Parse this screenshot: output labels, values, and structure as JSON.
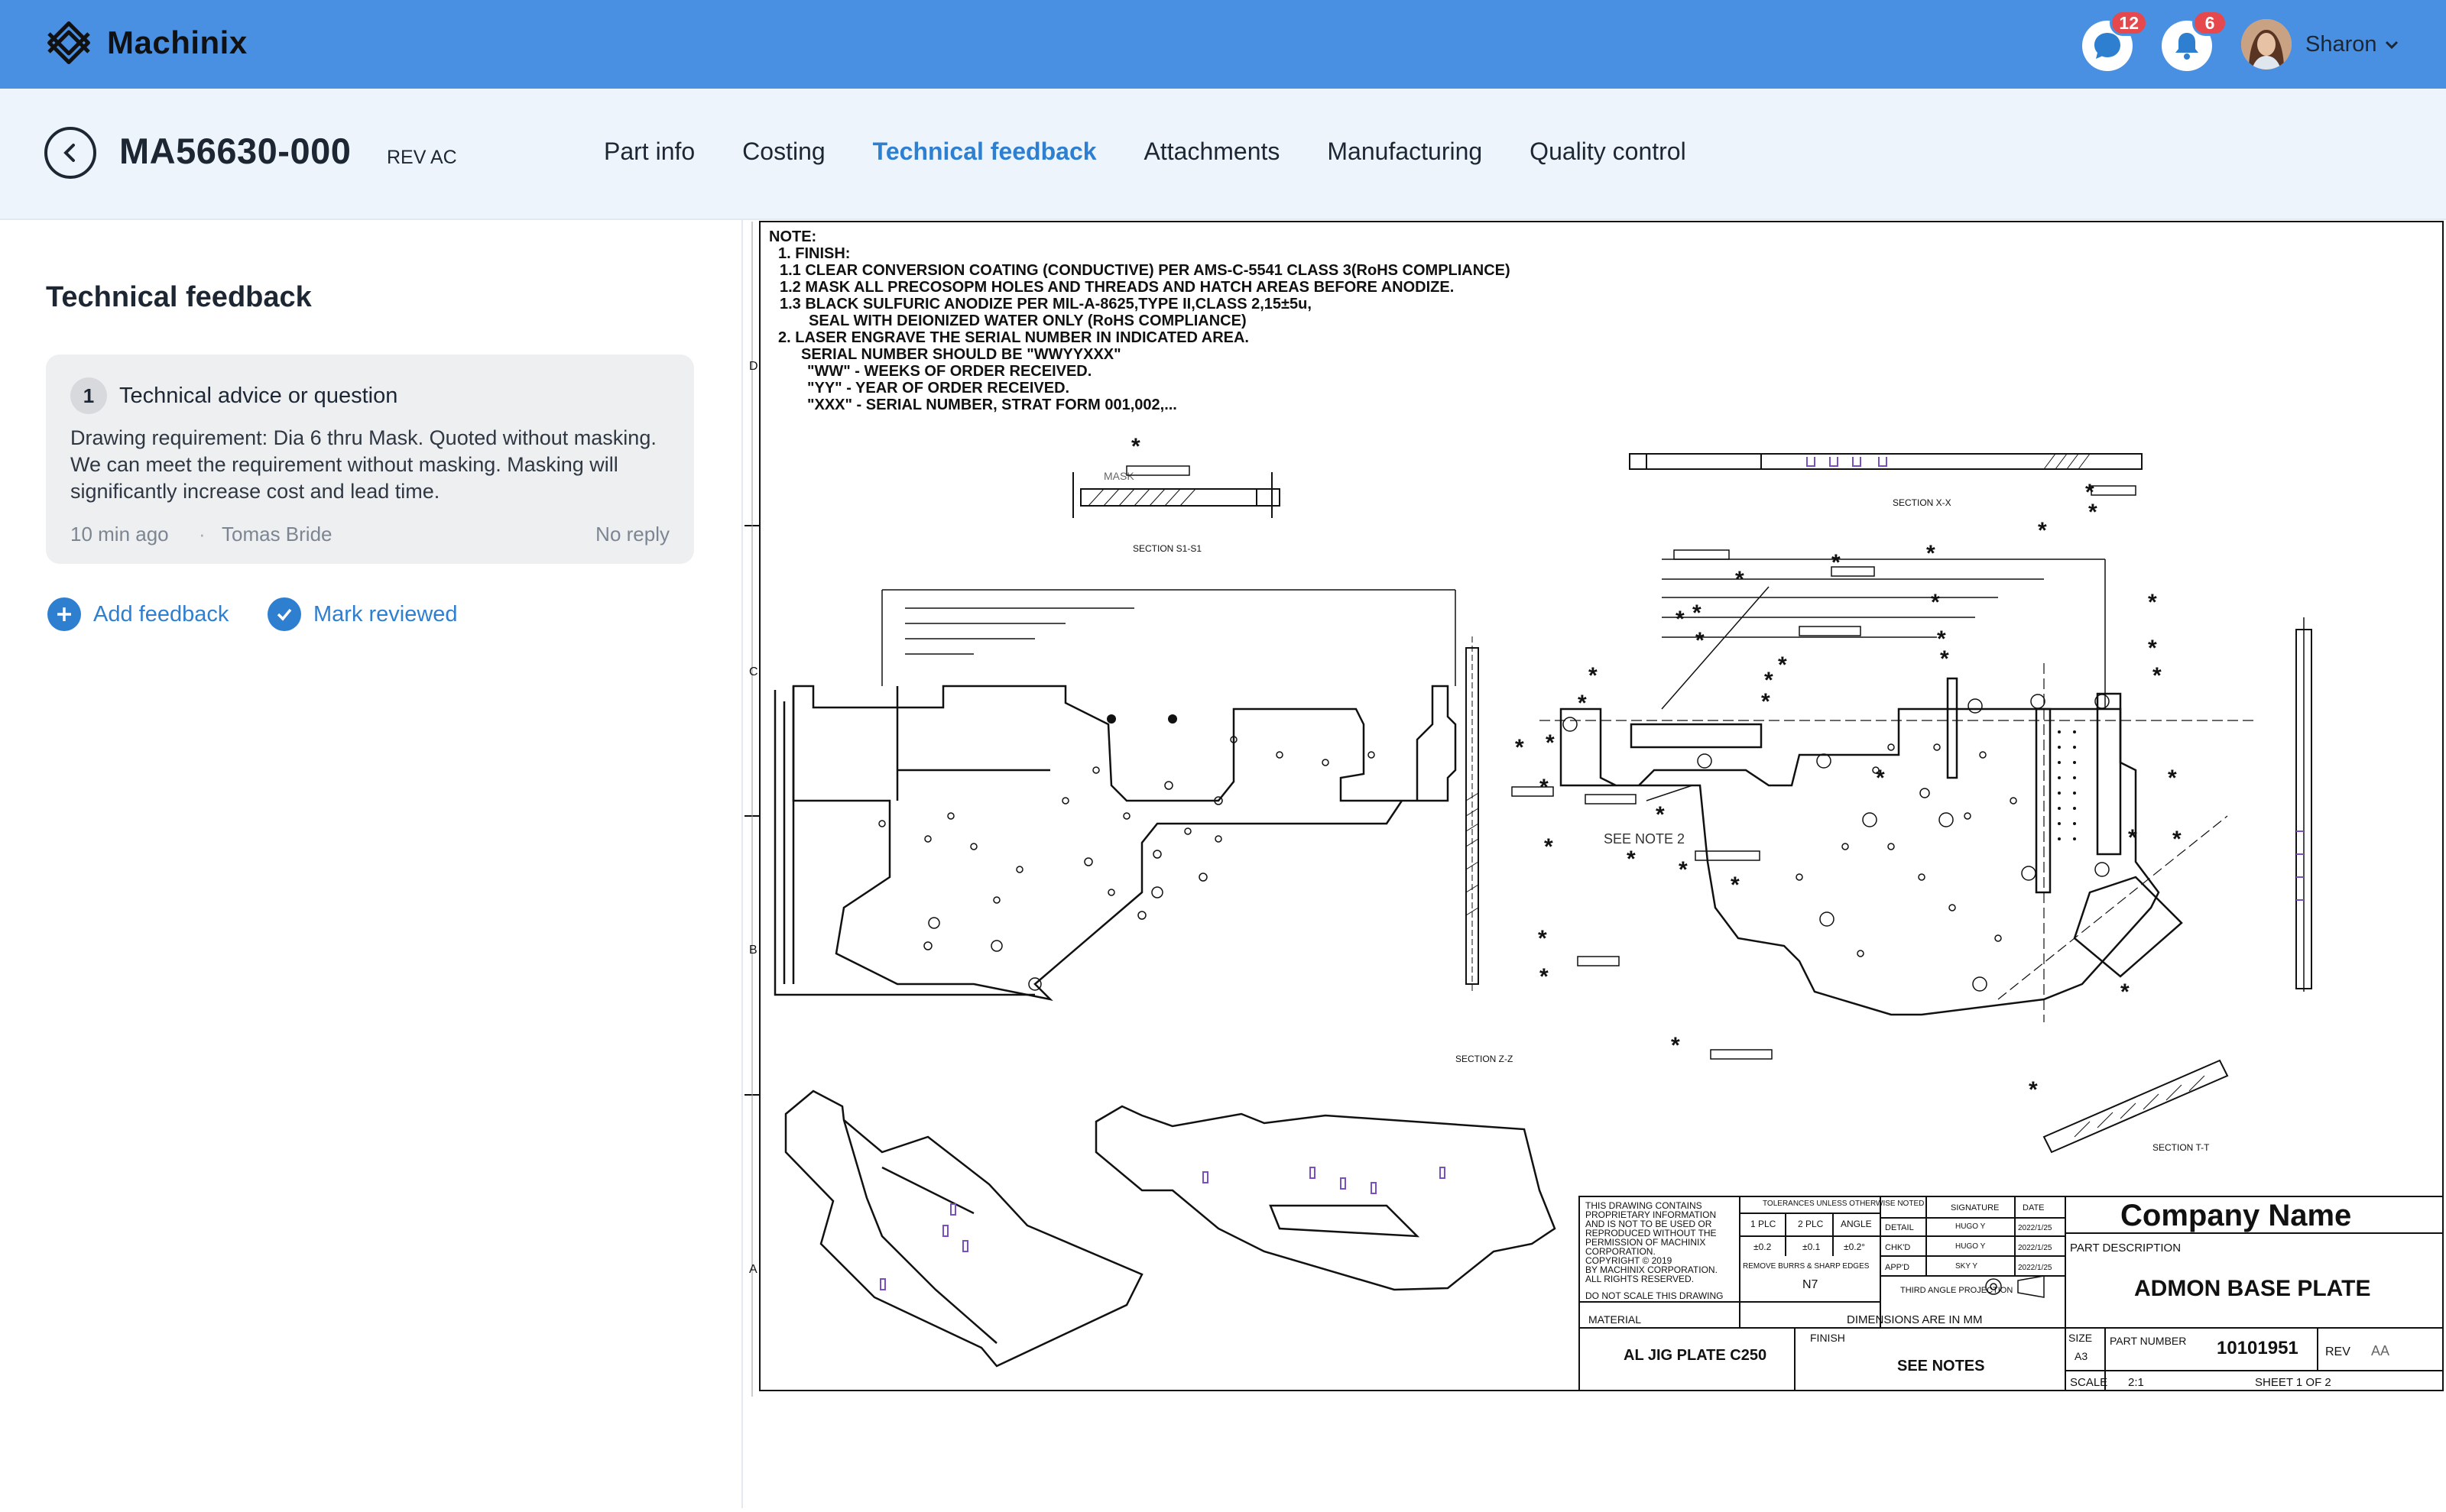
{
  "app": {
    "name": "Machinix"
  },
  "topbar": {
    "messages_count": "12",
    "notifications_count": "6",
    "user_name": "Sharon"
  },
  "header": {
    "part_number": "MA56630-000",
    "revision": "REV AC",
    "tabs": [
      "Part info",
      "Costing",
      "Technical feedback",
      "Attachments",
      "Manufacturing",
      "Quality control"
    ],
    "active_tab": "Technical feedback"
  },
  "panel": {
    "title": "Technical feedback",
    "feedback": [
      {
        "number": "1",
        "type": "Technical advice or question",
        "body": "Drawing requirement: Dia 6 thru Mask. Quoted without masking. We can meet the requirement without masking. Masking will significantly increase cost and lead time.",
        "time": "10 min ago",
        "author": "Tomas Bride",
        "reply_status": "No reply"
      }
    ],
    "add_feedback_label": "Add feedback",
    "mark_reviewed_label": "Mark reviewed"
  },
  "drawing": {
    "notes": [
      "NOTE:",
      "1. FINISH:",
      "1.1 CLEAR CONVERSION COATING (CONDUCTIVE) PER AMS-C-5541 CLASS 3(RoHS COMPLIANCE)",
      "1.2 MASK ALL PRECOSOPM HOLES AND THREADS AND HATCH AREAS BEFORE ANODIZE.",
      "1.3 BLACK SULFURIC ANODIZE PER MIL-A-8625,TYPE II,CLASS 2,15±5u,",
      "SEAL WITH DEIONIZED WATER ONLY (RoHS COMPLIANCE)",
      "2. LASER ENGRAVE THE SERIAL NUMBER IN INDICATED AREA.",
      "SERIAL NUMBER SHOULD BE \"WWYYXXX\"",
      "\"WW\" - WEEKS OF ORDER RECEIVED.",
      "\"YY\" - YEAR OF ORDER RECEIVED.",
      "\"XXX\" - SERIAL NUMBER, STRAT FORM 001,002,..."
    ],
    "section_labels": [
      "SECTION S1-S1",
      "SECTION X-X",
      "SECTION Z-Z",
      "SECTION T-T"
    ],
    "see_note": "SEE NOTE 2",
    "mask_label": "MASK",
    "zone_letters": [
      "D",
      "C",
      "B",
      "A"
    ],
    "title_block": {
      "company_name": "Company Name",
      "part_description_label": "PART DESCRIPTION",
      "part_description": "ADMON BASE PLATE",
      "proprietary": "THIS DRAWING CONTAINS PROPRIETARY INFORMATION AND IS NOT TO BE USED OR REPRODUCED WITHOUT THE PERMISSION OF MACHINIX CORPORATION. COPYRIGHT © 2019 BY MACHINIX CORPORATION. ALL RIGHTS RESERVED.",
      "do_not_scale": "DO NOT SCALE THIS DRAWING",
      "tolerances": "TOLERANCES UNLESS OTHERWISE NOTED",
      "tol_headers": [
        "1 PLC",
        "2 PLC",
        "ANGLE"
      ],
      "tol_values": [
        "±0.2",
        "±0.1",
        "±0.2°"
      ],
      "remove_burrs": "REMOVE BURRS & SHARP EDGES",
      "surface": "N7",
      "signature_label": "SIGNATURE",
      "date_label": "DATE",
      "detail_label": "DETAIL",
      "chkd_label": "CHK'D",
      "appd_label": "APP'D",
      "signatures": [
        "HUGO Y",
        "HUGO Y",
        "SKY Y"
      ],
      "dates": [
        "2022/1/25",
        "2022/1/25",
        "2022/1/25"
      ],
      "projection": "THIRD ANGLE PROJECTION",
      "material_label": "MATERIAL",
      "material": "AL JIG PLATE C250",
      "dimensions_note": "DIMENSIONS ARE IN MM",
      "finish_label": "FINISH",
      "finish": "SEE NOTES",
      "size_label": "SIZE",
      "size": "A3",
      "part_number_label": "PART NUMBER",
      "part_number": "10101951",
      "rev_label": "REV",
      "rev": "AA",
      "scale_label": "SCALE",
      "scale": "2:1",
      "sheet": "SHEET 1 OF 2"
    }
  }
}
